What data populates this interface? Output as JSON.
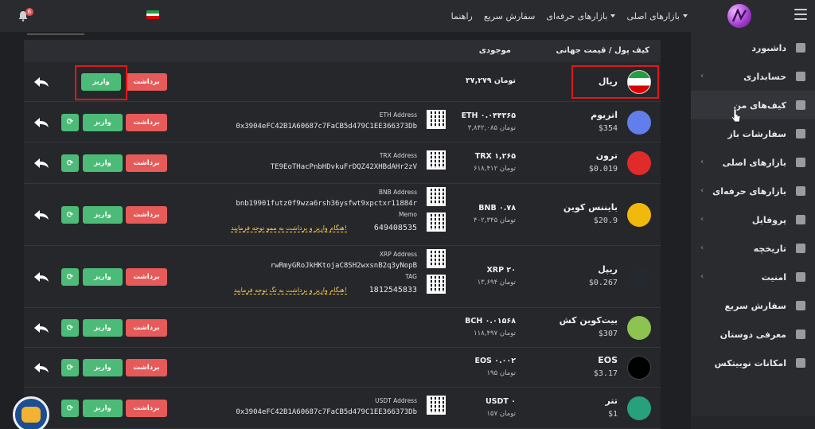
{
  "topbar": {
    "nav": [
      {
        "label": "بازارهای اصلی",
        "caret": true
      },
      {
        "label": "بازارهای حرفه‌ای",
        "caret": true
      },
      {
        "label": "سفارش سریع",
        "caret": false
      },
      {
        "label": "راهنما",
        "caret": false
      }
    ],
    "notifications_count": "6",
    "flag_colors": [
      "#239f40",
      "#ffffff",
      "#da0000"
    ]
  },
  "sidebar": {
    "items": [
      {
        "label": "داشبورد",
        "icon": "dashboard-icon",
        "chevron": false,
        "active": false
      },
      {
        "label": "حسابداری",
        "icon": "accounting-icon",
        "chevron": true,
        "active": false
      },
      {
        "label": "کیف‌های من",
        "icon": "wallet-icon",
        "chevron": false,
        "active": true
      },
      {
        "label": "سفارشات باز",
        "icon": "orders-icon",
        "chevron": false,
        "active": false
      },
      {
        "label": "بازارهای اصلی",
        "icon": "market-icon",
        "chevron": true,
        "active": false
      },
      {
        "label": "بازارهای حرفه‌ای",
        "icon": "pro-market-icon",
        "chevron": true,
        "active": false
      },
      {
        "label": "پروفایل",
        "icon": "profile-icon",
        "chevron": true,
        "active": false
      },
      {
        "label": "تاریخچه",
        "icon": "history-icon",
        "chevron": true,
        "active": false
      },
      {
        "label": "امنیت",
        "icon": "shield-icon",
        "chevron": true,
        "active": false
      },
      {
        "label": "سفارش سریع",
        "icon": "fast-order-icon",
        "chevron": false,
        "active": false
      },
      {
        "label": "معرفی دوستان",
        "icon": "referral-icon",
        "chevron": false,
        "active": false
      },
      {
        "label": "امکانات نوبیتکس",
        "icon": "features-icon",
        "chevron": false,
        "active": false
      }
    ]
  },
  "table": {
    "header_wallet": "کیف پول / قیمت جهانی",
    "header_balance": "موجودی",
    "withdraw_label": "برداشت",
    "deposit_label": "واریز",
    "rows": [
      {
        "name": "ریال",
        "price": "",
        "amount": "۳۷,۲۷۹ تومان",
        "toman": "",
        "icon": "iran-flag-icon",
        "icon_color": "#ffffff"
      },
      {
        "name": "اتریوم",
        "price": "$354",
        "amount": "ETH ۰.۰۴۴۳۶۵",
        "toman": "۳,۸۴۲,۰۸۵ تومان",
        "icon": "ethereum-icon",
        "icon_color": "#627eea",
        "addr_label": "ETH Address",
        "addr": "0x3904eFC42B1A60687c7FaCB5d479C1EE366373Db"
      },
      {
        "name": "ترون",
        "price": "$0.019",
        "amount": "TRX ۱,۲۶۵",
        "toman": "۶۱۸,۴۱۲ تومان",
        "icon": "tron-icon",
        "icon_color": "#e12a2a",
        "addr_label": "TRX Address",
        "addr": "TE9EoTHacPnbHDvkuFrDQZ42XHBdAHr2zV"
      },
      {
        "name": "بایننس کوین",
        "price": "$20.9",
        "amount": "BNB ۰.۷۸",
        "toman": "۴۰۲,۳۴۵ تومان",
        "icon": "binance-icon",
        "icon_color": "#f0b90b",
        "addr_label": "BNB Address",
        "addr": "bnb19901futz0f9wza6rsh36ysfwt9xpctxr11884r",
        "memo_label": "Memo",
        "memo": "649408535",
        "warn": "هنگام واریز و برداشت به ممو توجه فرمایید!"
      },
      {
        "name": "ریپل",
        "price": "$0.267",
        "amount": "XRP ۲۰",
        "toman": "۱۳,۶۹۴ تومان",
        "icon": "ripple-icon",
        "icon_color": "#23292f",
        "addr_label": "XRP Address",
        "addr": "rwRmyGRoJkHKtojaC8SH2wxsnB2q3yNopB",
        "memo_label": "TAG",
        "memo": "1812545833",
        "warn": "هنگام واریز و برداشت به تگ توجه فرمایید!"
      },
      {
        "name": "بیت‌کوین کش",
        "price": "$307",
        "amount": "BCH ۰.۰۱۵۶۸",
        "toman": "۱۱۸,۴۹۷ تومان",
        "icon": "bitcoin-cash-icon",
        "icon_color": "#8dc351"
      },
      {
        "name": "EOS",
        "price": "$3.17",
        "amount": "EOS ۰.۰۰۲",
        "toman": "۱۹۵ تومان",
        "icon": "eos-icon",
        "icon_color": "#000000"
      },
      {
        "name": "تتر",
        "price": "$1",
        "amount": "USDT ۰",
        "toman": "۱۵۷ تومان",
        "icon": "tether-icon",
        "icon_color": "#26a17b",
        "addr_label": "USDT Address",
        "addr": "0x3904eFC42B1A60687c7FaCB5d479C1EE366373Db"
      }
    ]
  }
}
